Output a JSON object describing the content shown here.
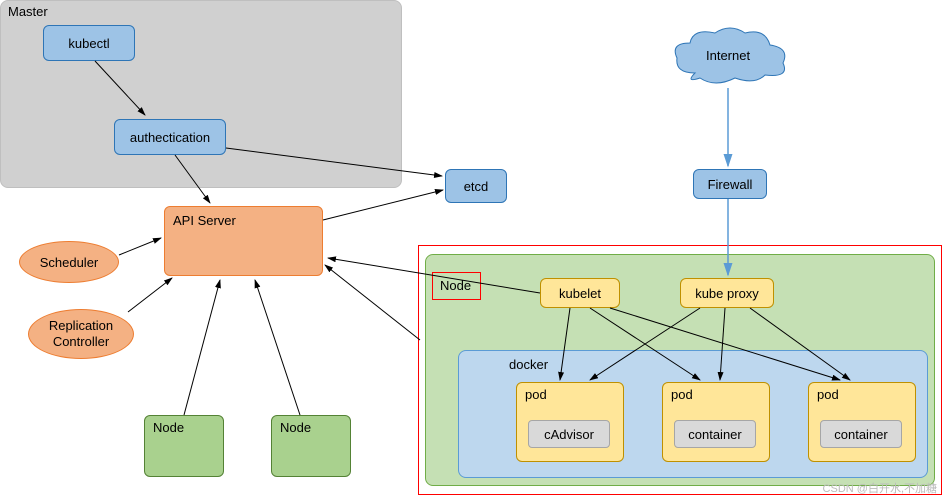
{
  "boxes": {
    "kubectl": "kubectl",
    "auth": "authectication",
    "apiServer": "API Server",
    "etcd": "etcd",
    "master": "Master",
    "scheduler": "Scheduler",
    "repController": "Replication\nController",
    "node1": "Node",
    "node2": "Node",
    "nodePanel": "Node",
    "kubelet": "kubelet",
    "kubeproxy": "kube proxy",
    "docker": "docker",
    "pod1": "pod",
    "pod2": "pod",
    "pod3": "pod",
    "cadvisor": "cAdvisor",
    "container1": "container",
    "container2": "container",
    "firewall": "Firewall",
    "internet": "Internet"
  },
  "watermark": "CSDN @白开水,不加糖"
}
